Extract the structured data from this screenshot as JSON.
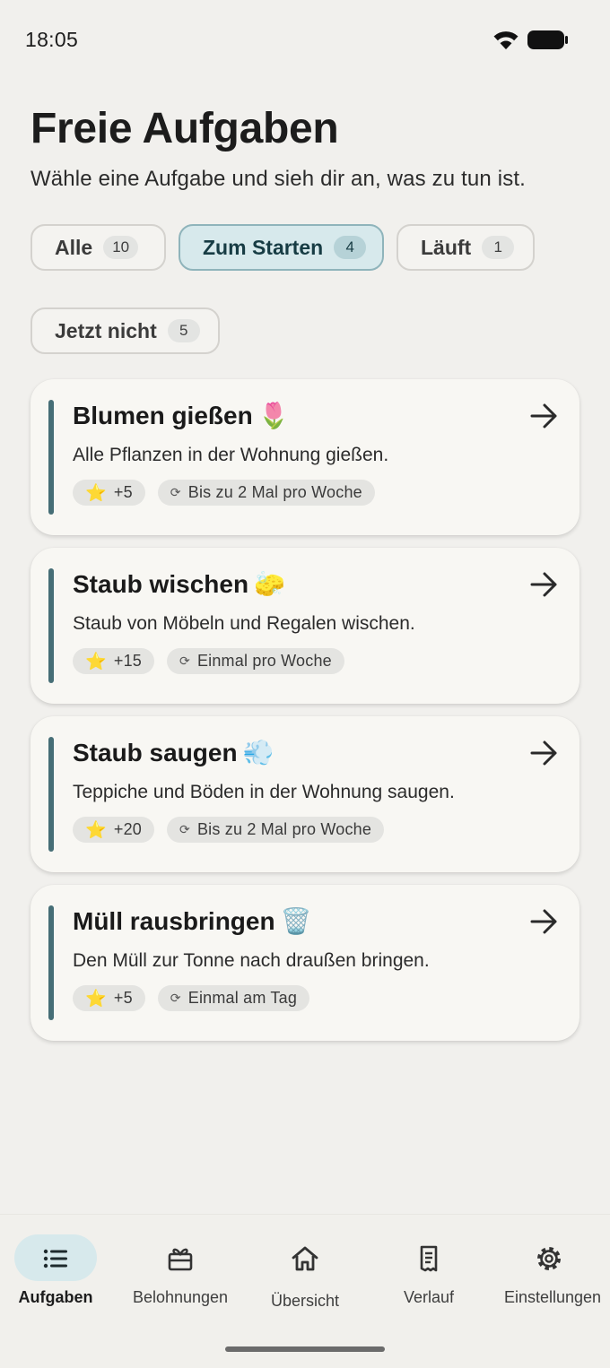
{
  "status_bar": {
    "time": "18:05"
  },
  "header": {
    "title": "Freie Aufgaben",
    "subtitle": "Wähle eine Aufgabe und sieh dir an, was zu tun ist."
  },
  "filters": [
    {
      "label": "Alle",
      "count": "10",
      "active": false
    },
    {
      "label": "Zum Starten",
      "count": "4",
      "active": true
    },
    {
      "label": "Läuft",
      "count": "1",
      "active": false
    },
    {
      "label": "Jetzt nicht",
      "count": "5",
      "active": false
    }
  ],
  "tasks": [
    {
      "title": "Blumen gießen",
      "emoji": "🌷",
      "description": "Alle Pflanzen in der Wohnung gießen.",
      "points": "+5",
      "frequency": "Bis zu 2 Mal pro Woche"
    },
    {
      "title": "Staub wischen",
      "emoji": "🧽",
      "description": "Staub von Möbeln und Regalen wischen.",
      "points": "+15",
      "frequency": "Einmal pro Woche"
    },
    {
      "title": "Staub saugen",
      "emoji": "💨",
      "description": "Teppiche und Böden in der Wohnung saugen.",
      "points": "+20",
      "frequency": "Bis zu 2 Mal pro Woche"
    },
    {
      "title": "Müll rausbringen",
      "emoji": "🗑️",
      "description": "Den Müll zur Tonne nach draußen bringen.",
      "points": "+5",
      "frequency": "Einmal am Tag"
    }
  ],
  "icons": {
    "star": "⭐",
    "repeat": "⟳"
  },
  "nav": [
    {
      "label": "Aufgaben",
      "icon": "list-icon",
      "active": true
    },
    {
      "label": "Belohnungen",
      "icon": "gift-icon",
      "active": false
    },
    {
      "label": "Übersicht",
      "icon": "home-icon",
      "active": false
    },
    {
      "label": "Verlauf",
      "icon": "receipt-icon",
      "active": false
    },
    {
      "label": "Einstellungen",
      "icon": "gear-icon",
      "active": false
    }
  ],
  "colors": {
    "accent": "#466e76",
    "active_chip": "#d7e9ec",
    "background": "#f1f0ed",
    "card": "#f8f7f3"
  }
}
